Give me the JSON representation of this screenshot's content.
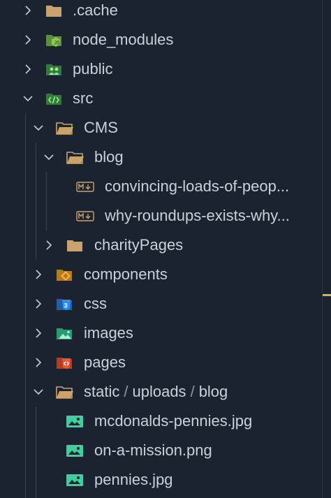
{
  "explorer": {
    "rows": [
      {
        "label": ".cache",
        "icon": "folder-icon",
        "expanded": false
      },
      {
        "label": "node_modules",
        "icon": "node-folder-icon",
        "expanded": false
      },
      {
        "label": "public",
        "icon": "public-folder-icon",
        "expanded": false
      },
      {
        "label": "src",
        "icon": "src-folder-icon",
        "expanded": true
      },
      {
        "label": "CMS",
        "icon": "folder-open-icon",
        "expanded": true
      },
      {
        "label": "blog",
        "icon": "folder-open-icon",
        "expanded": true
      },
      {
        "label": "convincing-loads-of-peop...",
        "icon": "markdown-icon"
      },
      {
        "label": "why-roundups-exists-why...",
        "icon": "markdown-icon"
      },
      {
        "label": "charityPages",
        "icon": "folder-icon",
        "expanded": false
      },
      {
        "label": "components",
        "icon": "components-folder-icon",
        "expanded": false
      },
      {
        "label": "css",
        "icon": "css-folder-icon",
        "expanded": false
      },
      {
        "label": "images",
        "icon": "images-folder-icon",
        "expanded": false
      },
      {
        "label": "pages",
        "icon": "pages-folder-icon",
        "expanded": false
      },
      {
        "path": [
          "static",
          "uploads",
          "blog"
        ],
        "separator": "/",
        "icon": "folder-open-icon",
        "expanded": true
      },
      {
        "label": "mcdonalds-pennies.jpg",
        "icon": "image-file-icon"
      },
      {
        "label": "on-a-mission.png",
        "icon": "image-file-icon"
      },
      {
        "label": "pennies.jpg",
        "icon": "image-file-icon"
      }
    ]
  },
  "colors": {
    "background": "#1c2330",
    "folder": "#c9a36b",
    "node": "#8cc84b",
    "public": "#4caf50",
    "src": "#4caf50",
    "components": "#e8a33d",
    "css": "#2f7fd6",
    "images": "#3fb68b",
    "pages": "#e05a3a",
    "image_file": "#3fcf9f",
    "markdown": "#c9a36b",
    "scroll_marker": "#d8b24a"
  }
}
